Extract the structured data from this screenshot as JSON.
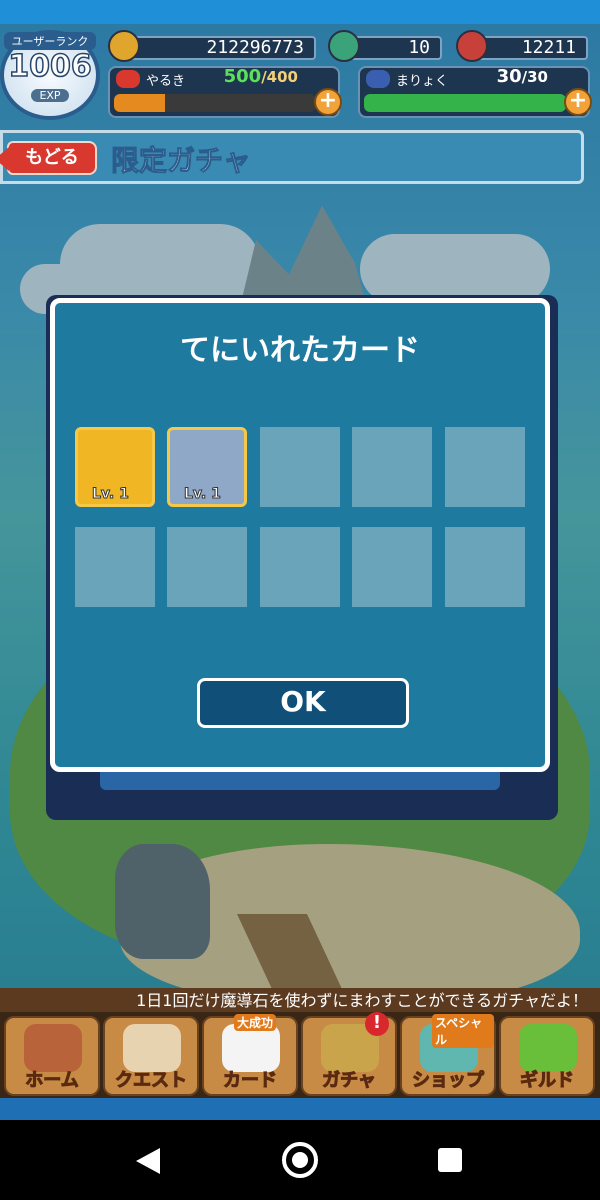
{
  "header": {
    "user_rank_label": "ユーザーランク",
    "user_rank_value": "1006",
    "exp_label": "EXP",
    "coins": "212296773",
    "magic_stones": "10",
    "third_currency": "12211",
    "yaruki": {
      "label": "やるき",
      "current": "500",
      "max": "/400",
      "fill": 0.25,
      "color": "#e58a1f"
    },
    "maryoku": {
      "label": "まりょく",
      "current": "30",
      "max": "/30",
      "fill": 1.0,
      "color": "#33b34a"
    },
    "plus_symbol": "+"
  },
  "titlebar": {
    "back_label": "もどる",
    "page_title": "限定ガチャ"
  },
  "modal": {
    "title": "てにいれたカード",
    "cards": [
      {
        "level": "Lv. 1",
        "color": "#f0b624"
      },
      {
        "level": "Lv. 1",
        "color": "#8fa8c8"
      }
    ],
    "empty_slots": 8,
    "ok_label": "OK"
  },
  "footer": {
    "marquee": "1日1回だけ魔導石を使わずにまわすことができるガチャだよ！",
    "menu": [
      {
        "label": "ホーム",
        "icon": "home-icon",
        "color": "#b9633a"
      },
      {
        "label": "クエスト",
        "icon": "map-icon",
        "color": "#e8d3b0"
      },
      {
        "label": "カード",
        "icon": "card-icon",
        "color": "#f4f4f4",
        "tag": "大成功"
      },
      {
        "label": "ガチャ",
        "icon": "gear-icon",
        "color": "#c9a44a",
        "badge": "!"
      },
      {
        "label": "ショップ",
        "icon": "shell-icon",
        "color": "#5fb7b0",
        "tag": "スペシャル"
      },
      {
        "label": "ギルド",
        "icon": "frog-icon",
        "color": "#6abf3a"
      }
    ]
  }
}
